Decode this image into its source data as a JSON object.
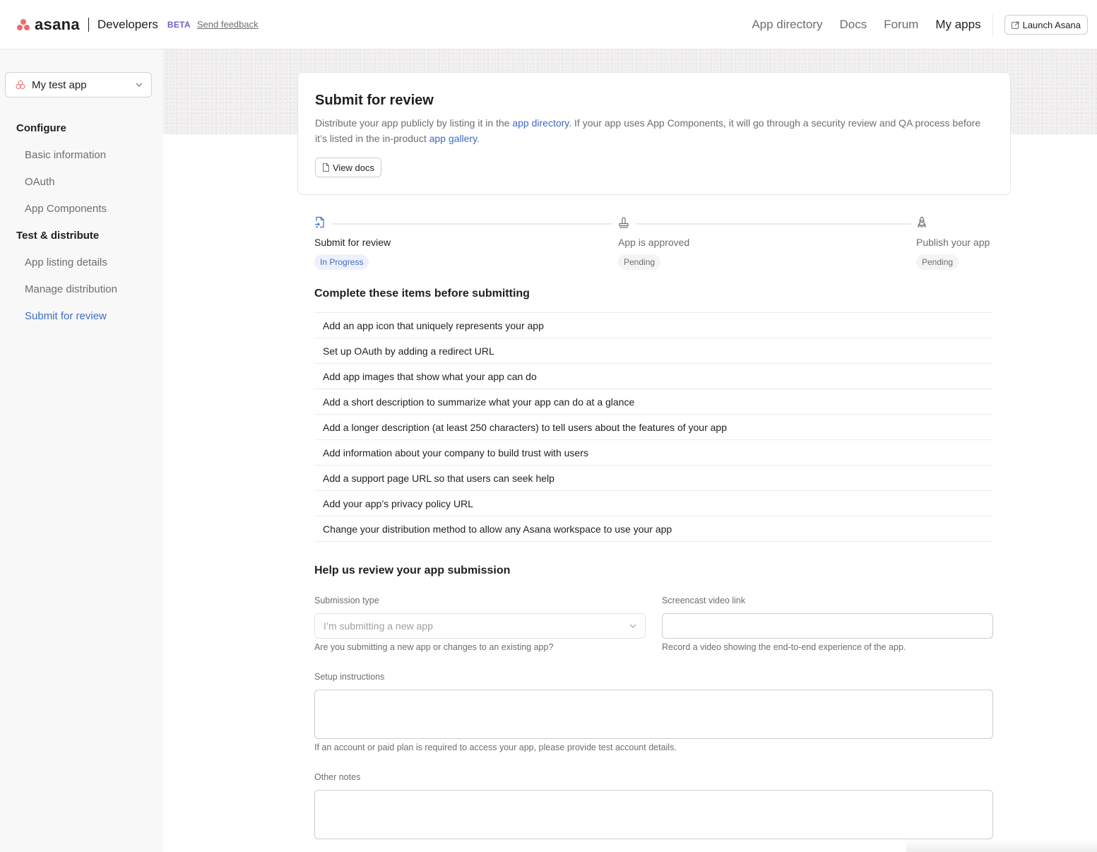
{
  "header": {
    "logo_text": "asana",
    "product": "Developers",
    "beta_label": "BETA",
    "feedback_link": "Send feedback",
    "nav": [
      {
        "label": "App directory",
        "active": false
      },
      {
        "label": "Docs",
        "active": false
      },
      {
        "label": "Forum",
        "active": false
      },
      {
        "label": "My apps",
        "active": true
      }
    ],
    "launch_button": {
      "label": "Launch Asana",
      "icon": "external-link-icon"
    }
  },
  "sidebar": {
    "app_selector": {
      "label": "My test app",
      "icon": "asana-app-icon"
    },
    "sections": [
      {
        "title": "Configure",
        "items": [
          {
            "label": "Basic information",
            "active": false
          },
          {
            "label": "OAuth",
            "active": false
          },
          {
            "label": "App Components",
            "active": false
          }
        ]
      },
      {
        "title": "Test & distribute",
        "items": [
          {
            "label": "App listing details",
            "active": false
          },
          {
            "label": "Manage distribution",
            "active": false
          },
          {
            "label": "Submit for review",
            "active": true
          }
        ]
      }
    ]
  },
  "intro_card": {
    "title": "Submit for review",
    "desc_part1": "Distribute your app publicly by listing it in the ",
    "link1": "app directory",
    "desc_part2": ". If your app uses App Components, it will go through a security review and QA process before it’s listed in the in-product ",
    "link2": "app gallery",
    "desc_part3": ".",
    "docs_button": "View docs"
  },
  "steps": [
    {
      "label": "Submit for review",
      "status": "In Progress",
      "icon": "submit-document-icon"
    },
    {
      "label": "App is approved",
      "status": "Pending",
      "icon": "approval-stamp-icon"
    },
    {
      "label": "Publish your app",
      "status": "Pending",
      "icon": "rocket-icon"
    }
  ],
  "checklist": {
    "title": "Complete these items before submitting",
    "items": [
      "Add an app icon that uniquely represents your app",
      "Set up OAuth by adding a redirect URL",
      "Add app images that show what your app can do",
      "Add a short description to summarize what your app can do at a glance",
      "Add a longer description (at least 250 characters) to tell users about the features of your app",
      "Add information about your company to build trust with users",
      "Add a support page URL so that users can seek help",
      "Add your app’s privacy policy URL",
      "Change your distribution method to allow any Asana workspace to use your app"
    ]
  },
  "form": {
    "title": "Help us review your app submission",
    "submission_type": {
      "label": "Submission type",
      "placeholder": "I’m submitting a new app",
      "help": "Are you submitting a new app or changes to an existing app?"
    },
    "screencast": {
      "label": "Screencast video link",
      "value": "",
      "help": "Record a video showing the end-to-end experience of the app."
    },
    "setup_instructions": {
      "label": "Setup instructions",
      "value": "",
      "help": "If an account or paid plan is required to access your app, please provide test account details."
    },
    "other_notes": {
      "label": "Other notes",
      "value": ""
    }
  },
  "colors": {
    "brand_coral": "#f06a6a",
    "beta_purple": "#6d5fc7",
    "link_blue": "#3d6bc4",
    "text_primary": "#1e1f21",
    "text_secondary": "#6d6e6f"
  }
}
